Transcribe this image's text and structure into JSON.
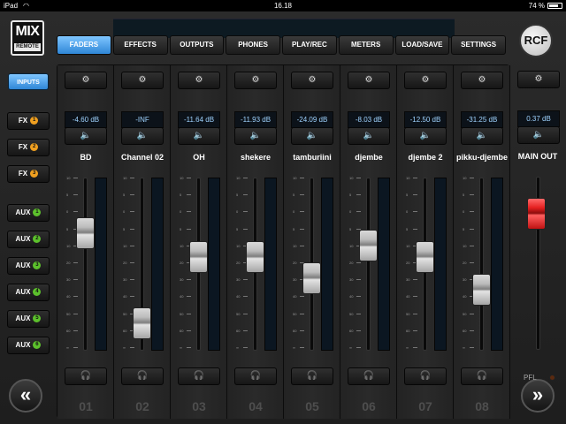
{
  "status_bar": {
    "device": "iPad",
    "time": "16.18",
    "battery": "74 %"
  },
  "logo": {
    "line1": "MIX",
    "line2": "REMOTE"
  },
  "tabs": [
    {
      "label": "FADERS",
      "active": true
    },
    {
      "label": "EFFECTS",
      "active": false
    },
    {
      "label": "OUTPUTS",
      "active": false
    },
    {
      "label": "PHONES",
      "active": false
    },
    {
      "label": "PLAY/REC",
      "active": false
    },
    {
      "label": "METERS",
      "active": false
    },
    {
      "label": "LOAD/SAVE",
      "active": false
    },
    {
      "label": "SETTINGS",
      "active": false
    }
  ],
  "brand_button": "RCF",
  "left_panel": {
    "inputs_label": "INPUTS",
    "fx": [
      {
        "label": "FX",
        "num": "1"
      },
      {
        "label": "FX",
        "num": "2"
      },
      {
        "label": "FX",
        "num": "3"
      }
    ],
    "aux": [
      {
        "label": "AUX",
        "num": "1"
      },
      {
        "label": "AUX",
        "num": "2"
      },
      {
        "label": "AUX",
        "num": "3"
      },
      {
        "label": "AUX",
        "num": "4"
      },
      {
        "label": "AUX",
        "num": "5"
      },
      {
        "label": "AUX",
        "num": "6"
      }
    ]
  },
  "nav": {
    "prev_glyph": "«",
    "next_glyph": "»"
  },
  "channels": [
    {
      "name": "BD",
      "db": "-4.60 dB",
      "number": "01",
      "fader_level": 0.72
    },
    {
      "name": "Channel 02",
      "db": "-INF",
      "number": "02",
      "fader_level": 0.08
    },
    {
      "name": "OH",
      "db": "-11.64 dB",
      "number": "03",
      "fader_level": 0.55
    },
    {
      "name": "shekere",
      "db": "-11.93 dB",
      "number": "04",
      "fader_level": 0.55
    },
    {
      "name": "tamburiini",
      "db": "-24.09 dB",
      "number": "05",
      "fader_level": 0.4
    },
    {
      "name": "djembe",
      "db": "-8.03 dB",
      "number": "06",
      "fader_level": 0.63
    },
    {
      "name": "djembe 2",
      "db": "-12.50 dB",
      "number": "07",
      "fader_level": 0.55
    },
    {
      "name": "pikku-djembe",
      "db": "-31.25 dB",
      "number": "08",
      "fader_level": 0.32
    }
  ],
  "main_out": {
    "name": "MAIN OUT",
    "db": "0.37 dB",
    "pfl_label": "PFL",
    "fader_level": 0.85
  },
  "fader_scale": [
    "10",
    "5",
    "0",
    "5",
    "10",
    "20",
    "30",
    "40",
    "50",
    "60",
    "∞"
  ],
  "icons": {
    "settings": "gear-icon",
    "mute": "speaker-mute-icon",
    "pfl": "headphones-icon"
  },
  "colors": {
    "accent": "#2f86d6",
    "fx_badge": "#f0a020",
    "aux_badge": "#5cc02c",
    "main_fader": "#e52020"
  }
}
